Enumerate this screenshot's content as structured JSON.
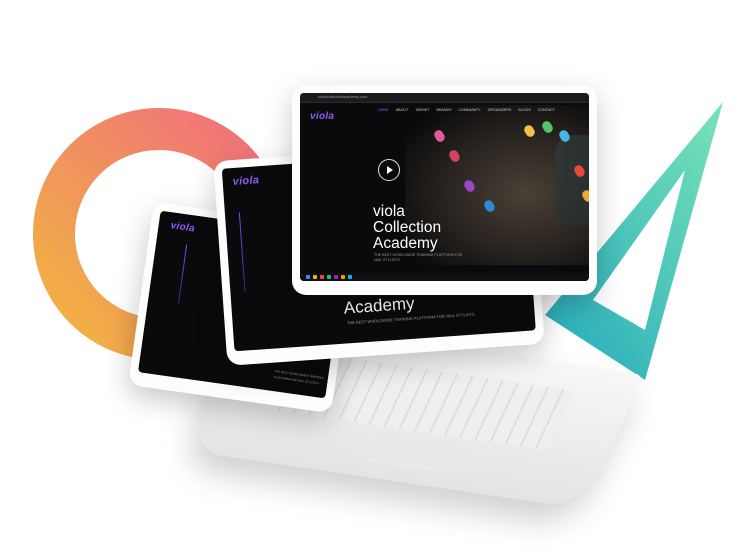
{
  "brand": {
    "logo_text": "viola"
  },
  "front_screen": {
    "url": "violacollectionacademy.com",
    "nav_items": [
      "HOME",
      "ABOUT",
      "TARGET",
      "BRANDS",
      "COMMUNITY",
      "ORGANIZERS",
      "BLOGS",
      "CONTACT"
    ],
    "hero_title": "viola\nCollection\nAcademy",
    "hero_subtitle": "THE BEST WORLDWIDE TRAINING PLATFORM FOR NAIL STYLISTS"
  },
  "mid_screen": {
    "hero_title": "Academy",
    "hero_subtitle": "THE BEST WORLDWIDE TRAINING PLATFORM FOR NAIL STYLISTS"
  },
  "back_screen": {
    "hero_subtitle": "THE BEST WORLDWIDE TRAINING PLATFORM FOR NAIL STYLISTS"
  },
  "colors": {
    "accent": "#8a5cf6",
    "ring_start": "#f2b441",
    "ring_end": "#ef6f7d",
    "triangle_start": "#7ae3b7",
    "triangle_end": "#22a9bd"
  },
  "icons": [
    "play-icon",
    "viola-logo-icon"
  ]
}
